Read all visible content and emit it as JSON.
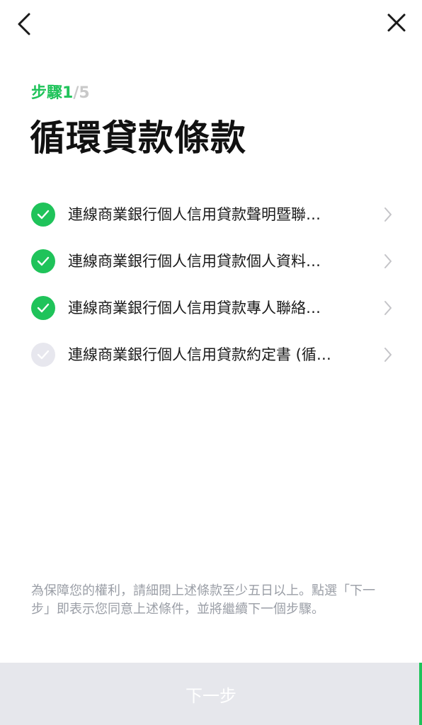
{
  "header": {
    "back_icon": "chevron-left-icon",
    "close_icon": "close-icon"
  },
  "step": {
    "label": "步驟",
    "current": "1",
    "separator": "/",
    "total": "5"
  },
  "title": "循環貸款條款",
  "terms": [
    {
      "label": "連線商業銀行個人信用貸款聲明暨聯…",
      "agreed": true
    },
    {
      "label": "連線商業銀行個人信用貸款個人資料…",
      "agreed": true
    },
    {
      "label": "連線商業銀行個人信用貸款專人聯絡…",
      "agreed": true
    },
    {
      "label": "連線商業銀行個人信用貸款約定書 (循…",
      "agreed": false
    }
  ],
  "notice": "為保障您的權利，請細閱上述條款至少五日以上。點選「下一步」即表示您同意上述條件，並將繼續下一個步驟。",
  "next_button": {
    "label": "下一步"
  },
  "colors": {
    "accent": "#1fc35a",
    "check_todo": "#e7e7ee",
    "button_disabled": "#e6e7ec",
    "notice_text": "#9a9ea6"
  }
}
